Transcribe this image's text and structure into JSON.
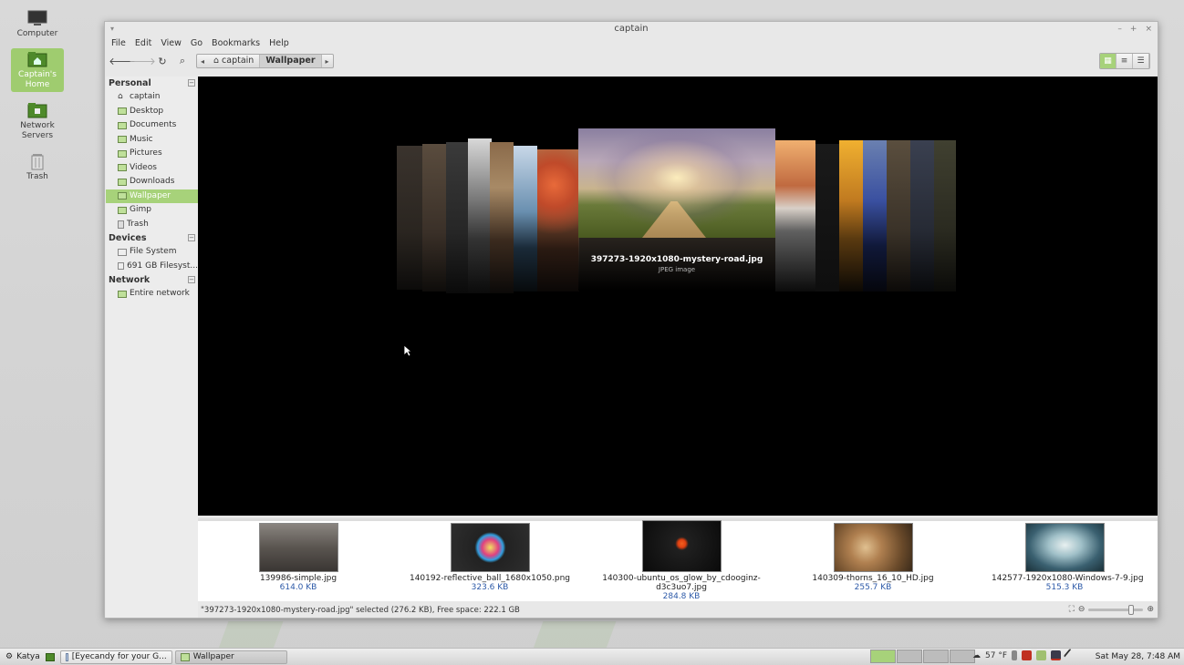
{
  "desktop": {
    "icons": [
      {
        "label": "Computer",
        "icon": "computer-icon"
      },
      {
        "label": "Captain's Home",
        "icon": "home-folder-icon"
      },
      {
        "label": "Network Servers",
        "icon": "network-icon"
      },
      {
        "label": "Trash",
        "icon": "trash-icon"
      }
    ]
  },
  "window": {
    "title": "captain",
    "menu": [
      "File",
      "Edit",
      "View",
      "Go",
      "Bookmarks",
      "Help"
    ],
    "path": [
      "captain",
      "Wallpaper"
    ],
    "view_modes": [
      "icon-view",
      "list-view",
      "compact-view"
    ]
  },
  "sidebar": {
    "sections": [
      {
        "title": "Personal",
        "items": [
          "captain",
          "Desktop",
          "Documents",
          "Music",
          "Pictures",
          "Videos",
          "Downloads",
          "Wallpaper",
          "Gimp",
          "Trash"
        ]
      },
      {
        "title": "Devices",
        "items": [
          "File System",
          "691 GB Filesyst..."
        ]
      },
      {
        "title": "Network",
        "items": [
          "Entire network"
        ]
      }
    ],
    "selected": "Wallpaper"
  },
  "coverflow": {
    "current_name": "397273-1920x1080-mystery-road.jpg",
    "current_type": "JPEG image"
  },
  "files": [
    {
      "name": "139986-simple.jpg",
      "size": "614.0 KB"
    },
    {
      "name": "140192-reflective_ball_1680x1050.png",
      "size": "323.6 KB"
    },
    {
      "name": "140300-ubuntu_os_glow_by_cdooginz-d3c3uo7.jpg",
      "size": "284.8 KB"
    },
    {
      "name": "140309-thorns_16_10_HD.jpg",
      "size": "255.7 KB"
    },
    {
      "name": "142577-1920x1080-Windows-7-9.jpg",
      "size": "515.3 KB"
    }
  ],
  "status": {
    "text": "\"397273-1920x1080-mystery-road.jpg\" selected (276.2 KB), Free space: 222.1 GB",
    "zoom_level": 0.8
  },
  "taskbar": {
    "menu_label": "Katya",
    "tasks": [
      "[Eyecandy for your G...",
      "Wallpaper"
    ],
    "weather": "57 °F",
    "clock": "Sat May 28,  7:48 AM"
  },
  "colors": {
    "accent": "#a7d27a",
    "link": "#2d5aa8"
  }
}
